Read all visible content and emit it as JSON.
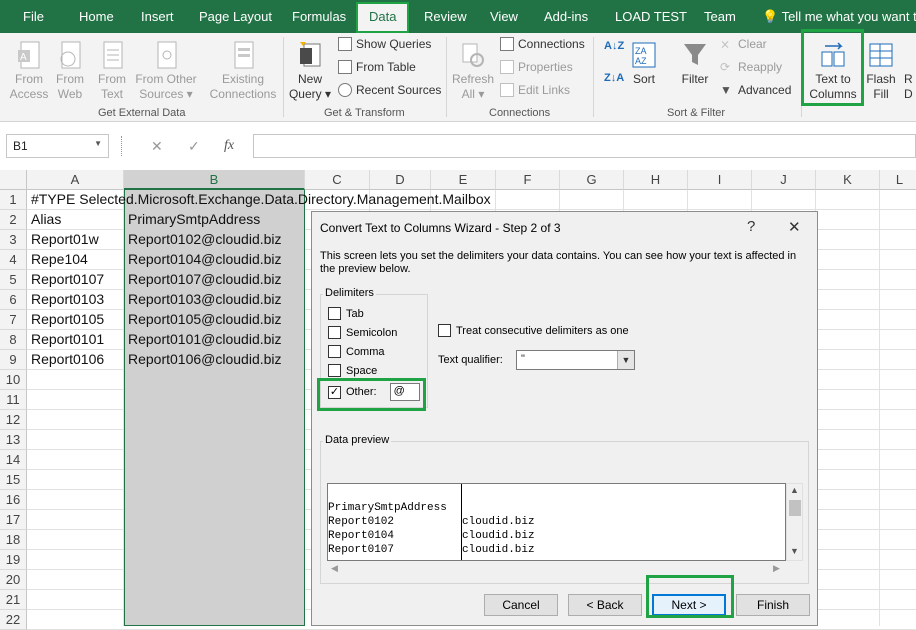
{
  "tabs": [
    "File",
    "Home",
    "Insert",
    "Page Layout",
    "Formulas",
    "Data",
    "Review",
    "View",
    "Add-ins",
    "LOAD TEST",
    "Team"
  ],
  "tell_me": "Tell me what you want to",
  "ribbon": {
    "get_external": {
      "label": "Get External Data",
      "from_access": [
        "From",
        "Access"
      ],
      "from_web": [
        "From",
        "Web"
      ],
      "from_text": [
        "From",
        "Text"
      ],
      "from_other": [
        "From Other",
        "Sources"
      ],
      "existing": [
        "Existing",
        "Connections"
      ]
    },
    "get_transform": {
      "label": "Get & Transform",
      "new_query": [
        "New",
        "Query"
      ],
      "show_queries": "Show Queries",
      "from_table": "From Table",
      "recent_sources": "Recent Sources"
    },
    "connections": {
      "label": "Connections",
      "refresh": [
        "Refresh",
        "All"
      ],
      "connections": "Connections",
      "properties": "Properties",
      "edit_links": "Edit Links"
    },
    "sort_filter": {
      "label": "Sort & Filter",
      "sort": "Sort",
      "filter": "Filter",
      "clear": "Clear",
      "reapply": "Reapply",
      "advanced": "Advanced"
    },
    "data_tools": {
      "text_to_columns": [
        "Text to",
        "Columns"
      ],
      "flash_fill": [
        "Flash",
        "Fill"
      ],
      "remove_dup": "R",
      "remove_dup2": "D"
    }
  },
  "name_box": "B1",
  "columns": [
    "A",
    "B",
    "C",
    "D",
    "E",
    "F",
    "G",
    "H",
    "I",
    "J",
    "K",
    "L"
  ],
  "rows": [
    "1",
    "2",
    "3",
    "4",
    "5",
    "6",
    "7",
    "8",
    "9",
    "10",
    "11",
    "12",
    "13",
    "14",
    "15",
    "16",
    "17",
    "18",
    "19",
    "20",
    "21",
    "22"
  ],
  "cells": {
    "a1": "#TYPE Selected.Microsoft.Exchange.Data.Directory.Management.Mailbox",
    "col_a": [
      "Alias",
      "Report01w",
      "Repe104",
      "Report0107",
      "Report0103",
      "Report0105",
      "Report0101",
      "Report0106"
    ],
    "col_b": [
      "PrimarySmtpAddress",
      "Report0102@cloudid.biz",
      "Report0104@cloudid.biz",
      "Report0107@cloudid.biz",
      "Report0103@cloudid.biz",
      "Report0105@cloudid.biz",
      "Report0101@cloudid.biz",
      "Report0106@cloudid.biz"
    ]
  },
  "dialog": {
    "title": "Convert Text to Columns Wizard - Step 2 of 3",
    "help": "?",
    "close": "✕",
    "description": "This screen lets you set the delimiters your data contains.  You can see how your text is affected in the preview below.",
    "delimiters_label": "Delimiters",
    "tab": "Tab",
    "semicolon": "Semicolon",
    "comma": "Comma",
    "space": "Space",
    "other": "Other:",
    "other_value": "@",
    "consecutive": "Treat consecutive delimiters as one",
    "qualifier_label": "Text qualifier:",
    "qualifier_value": "\"",
    "preview_label": "Data preview",
    "preview": [
      [
        "PrimarySmtpAddress",
        ""
      ],
      [
        "Report0102",
        "cloudid.biz"
      ],
      [
        "Report0104",
        "cloudid.biz"
      ],
      [
        "Report0107",
        "cloudid.biz"
      ]
    ],
    "buttons": {
      "cancel": "Cancel",
      "back": "< Back",
      "next": "Next >",
      "finish": "Finish"
    }
  }
}
